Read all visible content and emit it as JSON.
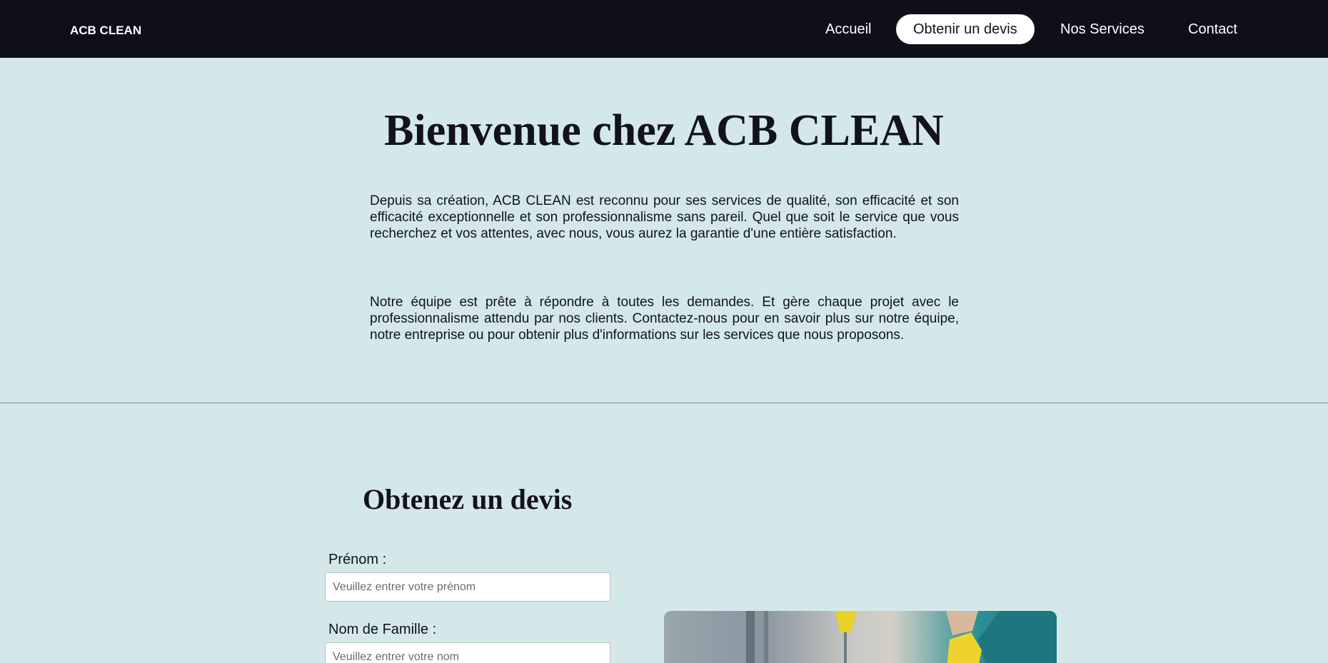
{
  "navbar": {
    "brand": "ACB CLEAN",
    "links": [
      {
        "label": "Accueil",
        "active": false
      },
      {
        "label": "Obtenir un devis",
        "active": true
      },
      {
        "label": "Nos Services",
        "active": false
      },
      {
        "label": "Contact",
        "active": false
      }
    ]
  },
  "hero": {
    "title": "Bienvenue chez ACB CLEAN",
    "paragraphs": [
      "Depuis sa création, ACB CLEAN est reconnu pour ses services de qualité, son efficacité et son efficacité exceptionnelle et son professionnalisme sans pareil. Quel que soit le service que vous recherchez et vos attentes, avec nous, vous aurez la garantie d'une entière satisfaction.",
      "Notre équipe est prête à répondre à toutes les demandes. Et gère chaque projet avec le professionnalisme attendu par nos clients. Contactez-nous pour en savoir plus sur notre équipe, notre entreprise ou pour obtenir plus d'informations sur les services que nous proposons."
    ]
  },
  "quote_form": {
    "title": "Obtenez un devis",
    "fields": [
      {
        "label": "Prénom :",
        "placeholder": "Veuillez entrer votre prénom",
        "value": ""
      },
      {
        "label": "Nom de Famille :",
        "placeholder": "Veuillez entrer votre nom",
        "value": ""
      }
    ]
  },
  "colors": {
    "navbar_bg": "#0f0f1a",
    "page_bg": "#d4e8ea",
    "active_pill_bg": "#ffffff",
    "text": "#12121c"
  },
  "icons": [
    "cleaning-photo"
  ]
}
